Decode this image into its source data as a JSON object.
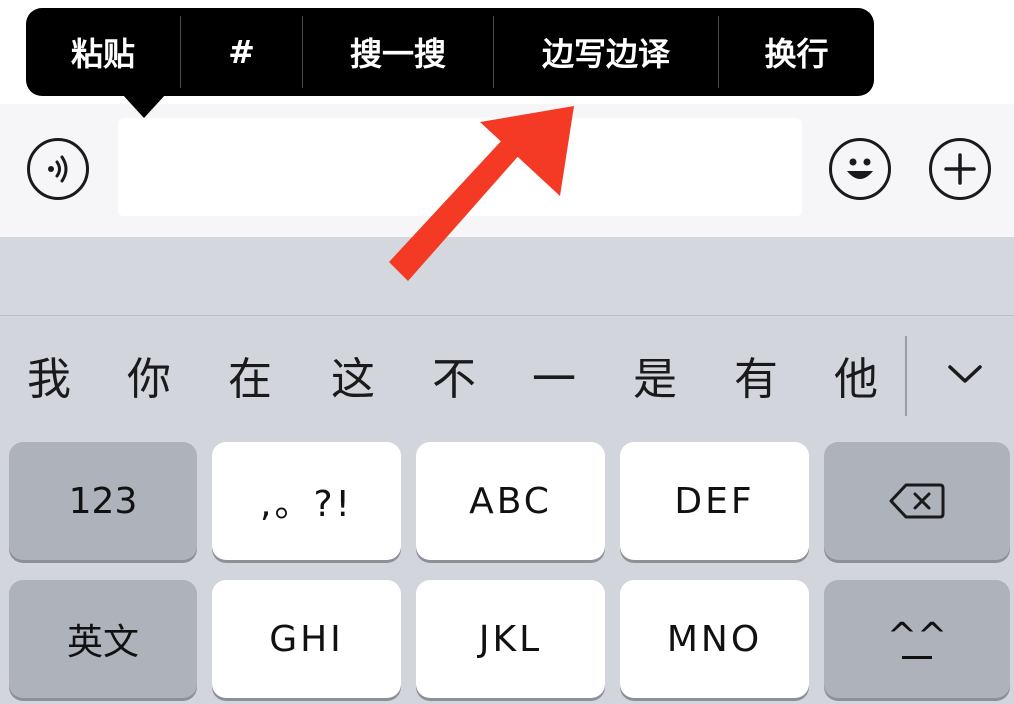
{
  "context_menu": {
    "items": [
      {
        "label": "粘贴"
      },
      {
        "label": "#"
      },
      {
        "label": "搜一搜"
      },
      {
        "label": "边写边译"
      },
      {
        "label": "换行"
      }
    ]
  },
  "input_bar": {
    "voice_icon": "voice-wave-icon",
    "emoji_icon": "smiley-icon",
    "plus_icon": "plus-icon",
    "message_value": ""
  },
  "candidates": [
    "我",
    "你",
    "在",
    "这",
    "不",
    "一",
    "是",
    "有",
    "他"
  ],
  "keyboard": {
    "row1": [
      {
        "label": "123",
        "style": "gray"
      },
      {
        "label": ",。?!",
        "style": "white"
      },
      {
        "label": "ABC",
        "style": "white"
      },
      {
        "label": "DEF",
        "style": "white"
      },
      {
        "label": "",
        "style": "gray",
        "icon": "backspace-icon"
      }
    ],
    "row2": [
      {
        "label": "英文",
        "style": "gray"
      },
      {
        "label": "GHI",
        "style": "white"
      },
      {
        "label": "JKL",
        "style": "white"
      },
      {
        "label": "MNO",
        "style": "white"
      },
      {
        "label": "^^",
        "style": "gray"
      }
    ]
  },
  "colors": {
    "popup_bg": "#000000",
    "arrow": "#f43a25",
    "keyboard_bg": "#d3d5dc",
    "function_key": "#aeb2bb"
  }
}
